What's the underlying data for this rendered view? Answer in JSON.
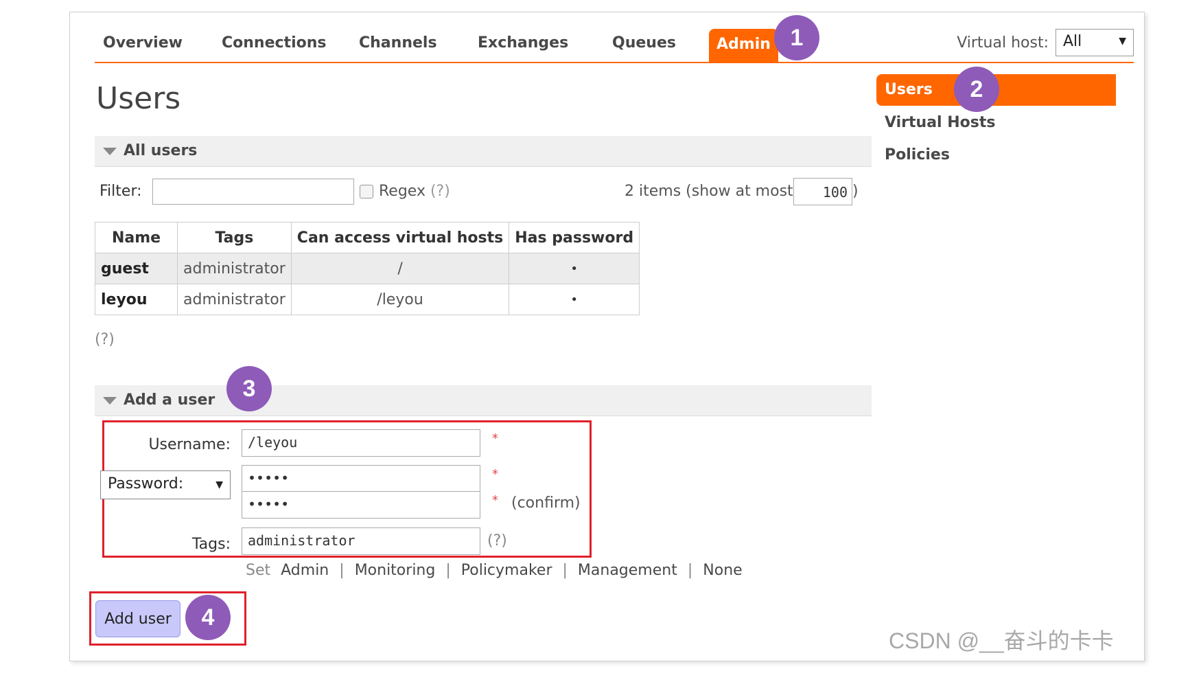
{
  "nav": {
    "tabs": [
      {
        "label": "Overview"
      },
      {
        "label": "Connections"
      },
      {
        "label": "Channels"
      },
      {
        "label": "Exchanges"
      },
      {
        "label": "Queues"
      },
      {
        "label": "Admin",
        "active": true
      }
    ],
    "virtual_host_label": "Virtual host:",
    "virtual_host_value": "All"
  },
  "page_title": "Users",
  "all_users": {
    "heading": "All users",
    "filter_label": "Filter:",
    "filter_value": "",
    "regex_label": "Regex",
    "regex_help": "(?)",
    "items_text": "2 items (show at most",
    "items_max": "100",
    "items_close": ")",
    "columns": [
      "Name",
      "Tags",
      "Can access virtual hosts",
      "Has password"
    ],
    "rows": [
      {
        "name": "guest",
        "tags": "administrator",
        "vhosts": "/",
        "has_password": "•"
      },
      {
        "name": "leyou",
        "tags": "administrator",
        "vhosts": "/leyou",
        "has_password": "•"
      }
    ],
    "help": "(?)"
  },
  "add_user": {
    "heading": "Add a user",
    "username_label": "Username:",
    "username_value": "/leyou",
    "password_mode": "Password:",
    "password_value": "•••••",
    "confirm_value": "•••••",
    "confirm_label": "(confirm)",
    "tags_label": "Tags:",
    "tags_value": "administrator",
    "tags_help": "(?)",
    "required_mark": "*",
    "set_label": "Set",
    "tag_options": [
      "Admin",
      "Monitoring",
      "Policymaker",
      "Management",
      "None"
    ],
    "separator": "|",
    "submit_label": "Add user"
  },
  "sidebar": {
    "items": [
      {
        "label": "Users",
        "active": true
      },
      {
        "label": "Virtual Hosts"
      },
      {
        "label": "Policies"
      }
    ]
  },
  "annotations": {
    "badges": [
      "1",
      "2",
      "3",
      "4"
    ],
    "badge_color": "#8e5bb8",
    "highlight_color": "#e0202a"
  },
  "colors": {
    "accent": "#ff6600",
    "button": "#c8c8fa"
  },
  "watermark": "CSDN @__奋斗的卡卡"
}
